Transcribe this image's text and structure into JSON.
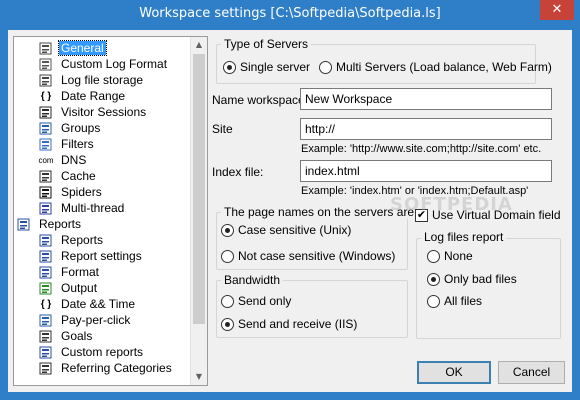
{
  "window": {
    "title": "Workspace settings [C:\\Softpedia\\Softpedia.ls]",
    "close_glyph": "✕"
  },
  "tree": {
    "items": [
      {
        "label": "General",
        "icon": "config-icon",
        "selected": true
      },
      {
        "label": "Custom Log Format",
        "icon": "document-icon"
      },
      {
        "label": "Log file storage",
        "icon": "storage-icon"
      },
      {
        "label": "Date Range",
        "icon": "braces-icon",
        "glyph": "{ }"
      },
      {
        "label": "Visitor Sessions",
        "icon": "visitor-icon"
      },
      {
        "label": "Groups",
        "icon": "groups-icon"
      },
      {
        "label": "Filters",
        "icon": "filter-icon"
      },
      {
        "label": "DNS",
        "icon": "dns-icon",
        "glyph": "com"
      },
      {
        "label": "Cache",
        "icon": "cache-icon"
      },
      {
        "label": "Spiders",
        "icon": "spider-icon"
      },
      {
        "label": "Multi-thread",
        "icon": "multithread-icon"
      },
      {
        "label": "Reports",
        "icon": "reports-icon"
      },
      {
        "label": "Reports",
        "icon": "report-icon"
      },
      {
        "label": "Report settings",
        "icon": "report-settings-icon"
      },
      {
        "label": "Format",
        "icon": "format-icon"
      },
      {
        "label": "Output",
        "icon": "output-icon"
      },
      {
        "label": "Date && Time",
        "icon": "braces-icon",
        "glyph": "{ }"
      },
      {
        "label": "Pay-per-click",
        "icon": "globe-icon"
      },
      {
        "label": "Goals",
        "icon": "goals-icon"
      },
      {
        "label": "Custom reports",
        "icon": "custom-reports-icon"
      },
      {
        "label": "Referring Categories",
        "icon": "categories-icon"
      }
    ]
  },
  "servers": {
    "group_title": "Type of Servers",
    "single": "Single server",
    "multi": "Multi Servers (Load balance, Web Farm)"
  },
  "workspace": {
    "name_label": "Name workspace:",
    "name_value": "New Workspace",
    "site_label": "Site",
    "site_value": "http://",
    "site_example": "Example: 'http://www.site.com;http://site.com' etc.",
    "index_label": "Index file:",
    "index_value": "index.html",
    "index_example": "Example: 'index.htm' or 'index.htm;Default.asp'"
  },
  "page_names": {
    "group_title": "The page names on the servers are:",
    "case_sensitive": "Case sensitive (Unix)",
    "not_case_sensitive": "Not case sensitive (Windows)"
  },
  "virtual_domain": {
    "label": "Use Virtual Domain field",
    "checked": true,
    "check_glyph": "✔"
  },
  "bandwidth": {
    "group_title": "Bandwidth",
    "send_only": "Send only",
    "send_receive": "Send and receive (IIS)"
  },
  "log_report": {
    "group_title": "Log files report",
    "none": "None",
    "bad": "Only bad files",
    "all": "All files"
  },
  "buttons": {
    "ok": "OK",
    "cancel": "Cancel"
  },
  "watermark": "SOFTPEDIA",
  "colors": {
    "title_bar": "#2f7fc8",
    "close_button": "#c7433a",
    "selection": "#3399ff",
    "dialog_bg": "#f0f0f0"
  }
}
